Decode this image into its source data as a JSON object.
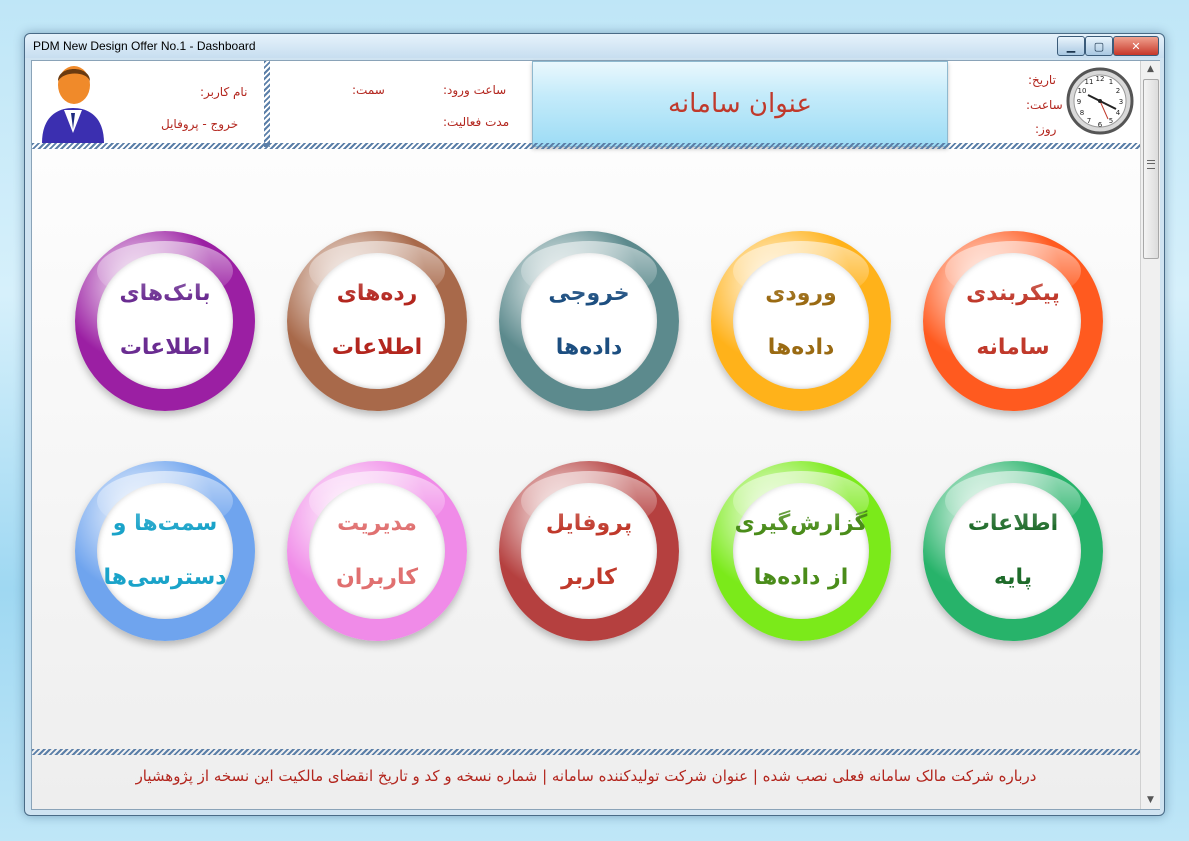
{
  "window": {
    "title": "PDM New Design Offer No.1 - Dashboard"
  },
  "header": {
    "user_label": "نام کاربر:",
    "logout_profile": "خروج - پروفایل",
    "position_label": "سمت:",
    "login_time_label": "ساعت ورود:",
    "active_duration_label": "مدت فعالیت:",
    "system_title": "عنوان سامانه",
    "date_label": "تاریخ:",
    "time_label": "ساعت:",
    "day_label": "روز:"
  },
  "tiles": [
    {
      "line1": "پیکربندی",
      "line2": "سامانه",
      "ring": "#ff5a1f",
      "color": "#c0392b"
    },
    {
      "line1": "ورودی",
      "line2": "داده‌ها",
      "ring": "#ffb21a",
      "color": "#9a6a12"
    },
    {
      "line1": "خروجی",
      "line2": "داده‌ها",
      "ring": "#5c8a8d",
      "color": "#1c4e80"
    },
    {
      "line1": "رده‌های",
      "line2": "اطلاعات",
      "ring": "#a8694a",
      "color": "#b3261e"
    },
    {
      "line1": "بانک‌های",
      "line2": "اطلاعات",
      "ring": "#9b1fa3",
      "color": "#6a2c91"
    },
    {
      "line1": "اطلاعات",
      "line2": "پایه",
      "ring": "#27b36a",
      "color": "#1e6b2a"
    },
    {
      "line1": "گزارش‌گیری",
      "line2": "از داده‌ها",
      "ring": "#7bea1a",
      "color": "#4a8c1a"
    },
    {
      "line1": "پروفایل",
      "line2": "کاربر",
      "ring": "#b5403f",
      "color": "#c0392b"
    },
    {
      "line1": "مدیریت",
      "line2": "کاربران",
      "ring": "#f08be8",
      "color": "#e07070"
    },
    {
      "line1": "سمت‌ها و",
      "line2": "دسترسی‌ها",
      "ring": "#6fa4ee",
      "color": "#1aa3c9"
    }
  ],
  "footer": {
    "text": "درباره شرکت مالک سامانه فعلی نصب شده | عنوان شرکت تولیدکننده سامانه | شماره نسخه و کد و تاریخ انقضای مالکیت این نسخه از پژوهشیار"
  },
  "icons": {
    "avatar": "user-avatar-icon",
    "clock": "analog-clock-icon"
  }
}
